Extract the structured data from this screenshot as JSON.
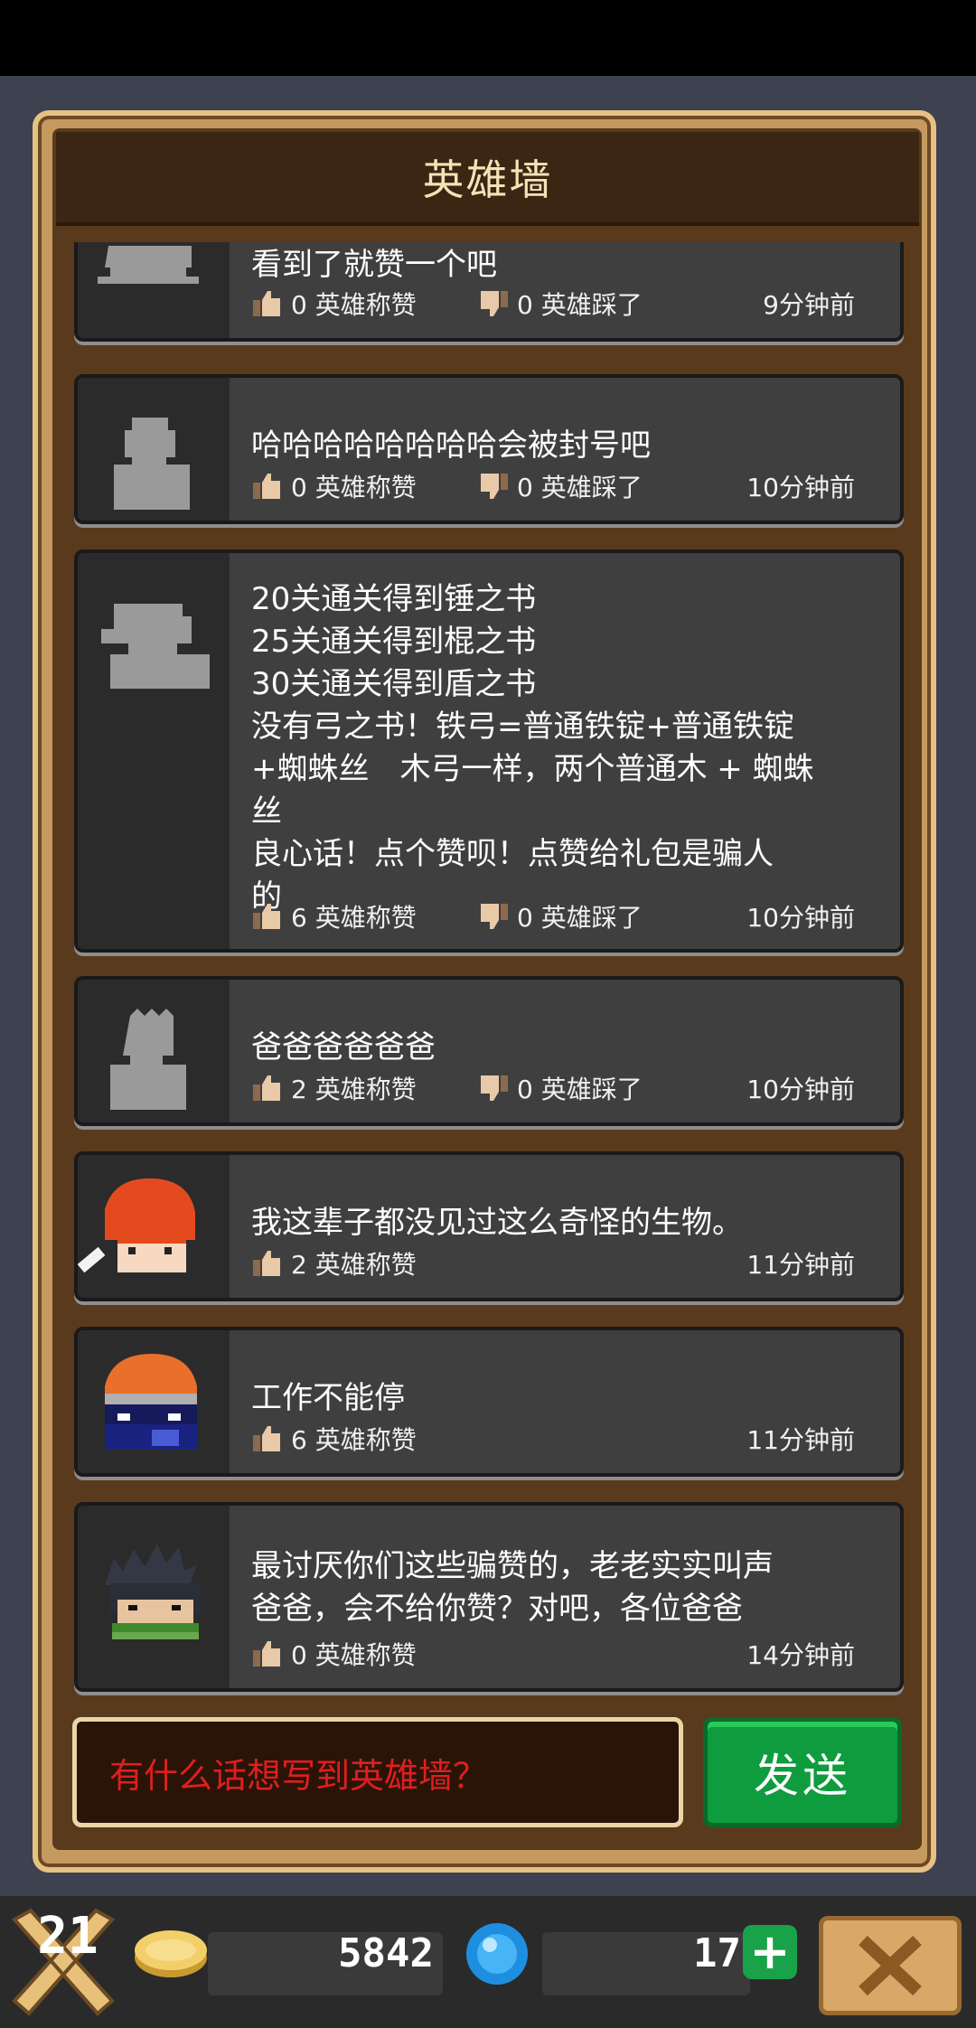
{
  "header": {
    "title": "英雄墙"
  },
  "posts": [
    {
      "message": "看到了就赞一个吧",
      "likes": "0 英雄称赞",
      "dislikes": "0 英雄踩了",
      "time": "9分钟前",
      "avatar": "silhouette-icon"
    },
    {
      "message": "哈哈哈哈哈哈哈哈会被封号吧",
      "likes": "0 英雄称赞",
      "dislikes": "0 英雄踩了",
      "time": "10分钟前",
      "avatar": "silhouette-icon"
    },
    {
      "message": "20关通关得到锤之书\n25关通关得到棍之书\n30关通关得到盾之书\n没有弓之书！铁弓=普通铁锭+普通铁锭\n+蜘蛛丝　木弓一样，两个普通木 + 蜘蛛\n丝\n良心话！点个赞呗！点赞给礼包是骗人\n的",
      "likes": "6 英雄称赞",
      "dislikes": "0 英雄踩了",
      "time": "10分钟前",
      "avatar": "silhouette-icon"
    },
    {
      "message": "爸爸爸爸爸爸",
      "likes": "2 英雄称赞",
      "dislikes": "0 英雄踩了",
      "time": "10分钟前",
      "avatar": "silhouette-icon"
    },
    {
      "message": "我这辈子都没见过这么奇怪的生物。",
      "likes": "2 英雄称赞",
      "time": "11分钟前",
      "avatar": "red-hair-hero-icon"
    },
    {
      "message": "工作不能停",
      "likes": "6 英雄称赞",
      "time": "11分钟前",
      "avatar": "orange-hair-hero-icon"
    },
    {
      "message": "最讨厌你们这些骗赞的，老老实实叫声\n爸爸，会不给你赞？对吧，各位爸爸",
      "likes": "0 英雄称赞",
      "time": "14分钟前",
      "avatar": "spiky-hair-hero-icon"
    }
  ],
  "composer": {
    "placeholder": "有什么话想写到英雄墙？",
    "send_label": "发送"
  },
  "bottom_bar": {
    "level": "21",
    "coins": "5842",
    "gems": "17",
    "plus_label": "+"
  },
  "colors": {
    "frame": "#c49a5f",
    "header_bg": "#3a2612",
    "card_bg": "#3c3c3c",
    "send_green": "#0f9c3f",
    "placeholder_red": "#e01e1e"
  }
}
